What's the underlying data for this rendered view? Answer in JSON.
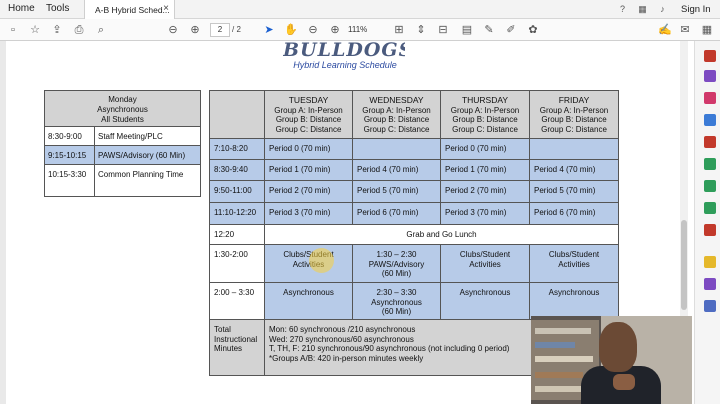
{
  "menubar": {
    "home": "Home",
    "tools": "Tools",
    "tab_title": "A-B Hybrid Sched...",
    "sign_in": "Sign In"
  },
  "toolbar": {
    "page_current": "2",
    "page_total": "/ 2",
    "zoom": "111%"
  },
  "document": {
    "logo_text": "BULLDOGS",
    "subtitle": "Hybrid Learning Schedule",
    "monday": {
      "header": [
        "Monday",
        "Asynchronous",
        "All Students"
      ],
      "rows": [
        {
          "time": "8:30-9:00",
          "desc": "Staff Meeting/PLC"
        },
        {
          "time": "9:15-10:15",
          "desc": "PAWS/Advisory (60 Min)"
        },
        {
          "time": "10:15-3:30",
          "desc": "Common Planning Time"
        }
      ]
    },
    "schedule": {
      "days": [
        {
          "day": "TUESDAY",
          "a": "Group A: In-Person",
          "b": "Group B: Distance",
          "c": "Group C: Distance"
        },
        {
          "day": "WEDNESDAY",
          "a": "Group A: In-Person",
          "b": "Group B: Distance",
          "c": "Group C: Distance"
        },
        {
          "day": "THURSDAY",
          "a": "Group A: In-Person",
          "b": "Group B: Distance",
          "c": "Group C: Distance"
        },
        {
          "day": "FRIDAY",
          "a": "Group A: In-Person",
          "b": "Group B: Distance",
          "c": "Group C: Distance"
        }
      ],
      "rows": [
        {
          "time": "7:10-8:20",
          "cells": [
            "Period 0 (70 min)",
            "",
            "Period 0 (70 min)",
            ""
          ]
        },
        {
          "time": "8:30-9:40",
          "cells": [
            "Period 1 (70 min)",
            "Period 4 (70 min)",
            "Period 1 (70 min)",
            "Period 4 (70 min)"
          ]
        },
        {
          "time": "9:50-11:00",
          "cells": [
            "Period 2 (70 min)",
            "Period 5 (70 min)",
            "Period 2 (70 min)",
            "Period 5 (70 min)"
          ]
        },
        {
          "time": "11:10-12:20",
          "cells": [
            "Period 3 (70 min)",
            "Period 6 (70 min)",
            "Period 3 (70 min)",
            "Period 6 (70 min)"
          ]
        }
      ],
      "lunch": {
        "time": "12:20",
        "label": "Grab and Go Lunch"
      },
      "clubs": {
        "time": "1:30-2:00",
        "tue": [
          "Clubs/Student",
          "Activities"
        ],
        "wed": [
          "1:30 – 2:30",
          "PAWS/Advisory",
          "(60 Min)"
        ],
        "thu": [
          "Clubs/Student",
          "Activities"
        ],
        "fri": [
          "Clubs/Student",
          "Activities"
        ]
      },
      "async": {
        "time": "2:00 – 3:30",
        "tue": "Asynchronous",
        "wed": [
          "2:30 – 3:30",
          "Asynchronous",
          "(60 Min)"
        ],
        "thu": "Asynchronous",
        "fri": "Asynchronous"
      },
      "total": {
        "label": [
          "Total",
          "Instructional",
          "Minutes"
        ],
        "lines": [
          "Mon: 60 synchronous /210 asynchronous",
          "Wed: 270 synchronous/60 asynchronous",
          "T, TH, F: 210 synchronous/90 asynchronous (not including 0 period)",
          "*Groups A/B: 420 in-person minutes weekly"
        ]
      }
    }
  },
  "colors": {
    "header_gray": "#d3d3d3",
    "cell_blue": "#b7cbe8",
    "subtitle_blue": "#2b4aa0"
  }
}
